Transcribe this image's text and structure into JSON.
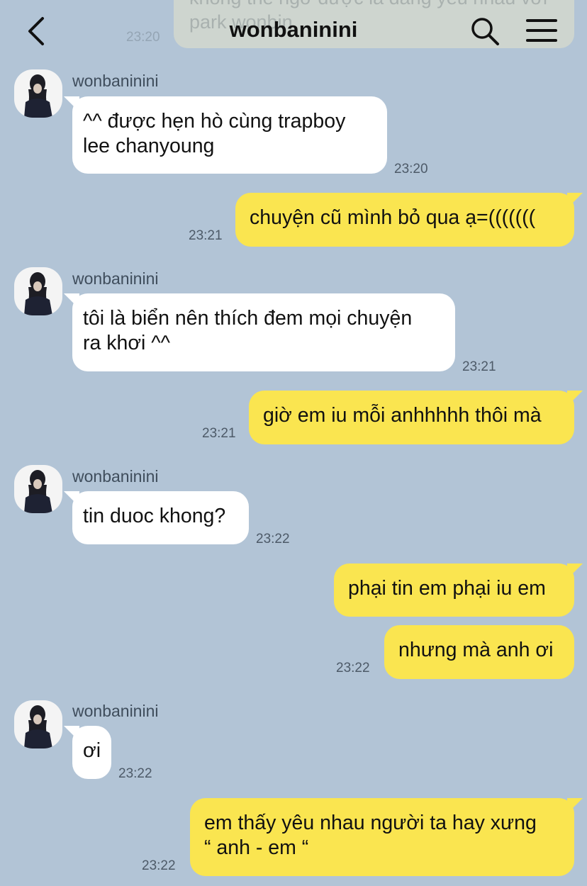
{
  "header": {
    "title": "wonbaninini",
    "back_icon": "chevron-left-icon",
    "search_icon": "search-icon",
    "menu_icon": "hamburger-menu-icon"
  },
  "previous_message": {
    "text": "không thể ngờ được là đang yêu nhau với park wonbin",
    "time": "23:20"
  },
  "messages": [
    {
      "sender": "wonbaninini",
      "text": "^^ được hẹn hò cùng trapboy\nlee chanyoung",
      "time": "23:20"
    },
    {
      "text": "chuyện cũ mình bỏ qua ạ=(((((((",
      "time": "23:21"
    },
    {
      "sender": "wonbaninini",
      "text": "tôi là biển nên thích đem mọi chuyện\nra khơi ^^",
      "time": "23:21"
    },
    {
      "text": "giờ em iu mỗi anhhhhh thôi mà",
      "time": "23:21"
    },
    {
      "sender": "wonbaninini",
      "text": "tin duoc khong?",
      "time": "23:22"
    },
    {
      "text": "phại tin em phại iu em"
    },
    {
      "text": "nhưng mà anh ơi",
      "time": "23:22"
    },
    {
      "sender": "wonbaninini",
      "text": "ơi",
      "time": "23:22"
    },
    {
      "text": "em thấy yêu nhau người ta hay xưng\n“ anh - em “",
      "time": "23:22"
    }
  ],
  "colors": {
    "background": "#b2c4d6",
    "outgoing_bubble": "#fae550",
    "incoming_bubble": "#ffffff"
  }
}
